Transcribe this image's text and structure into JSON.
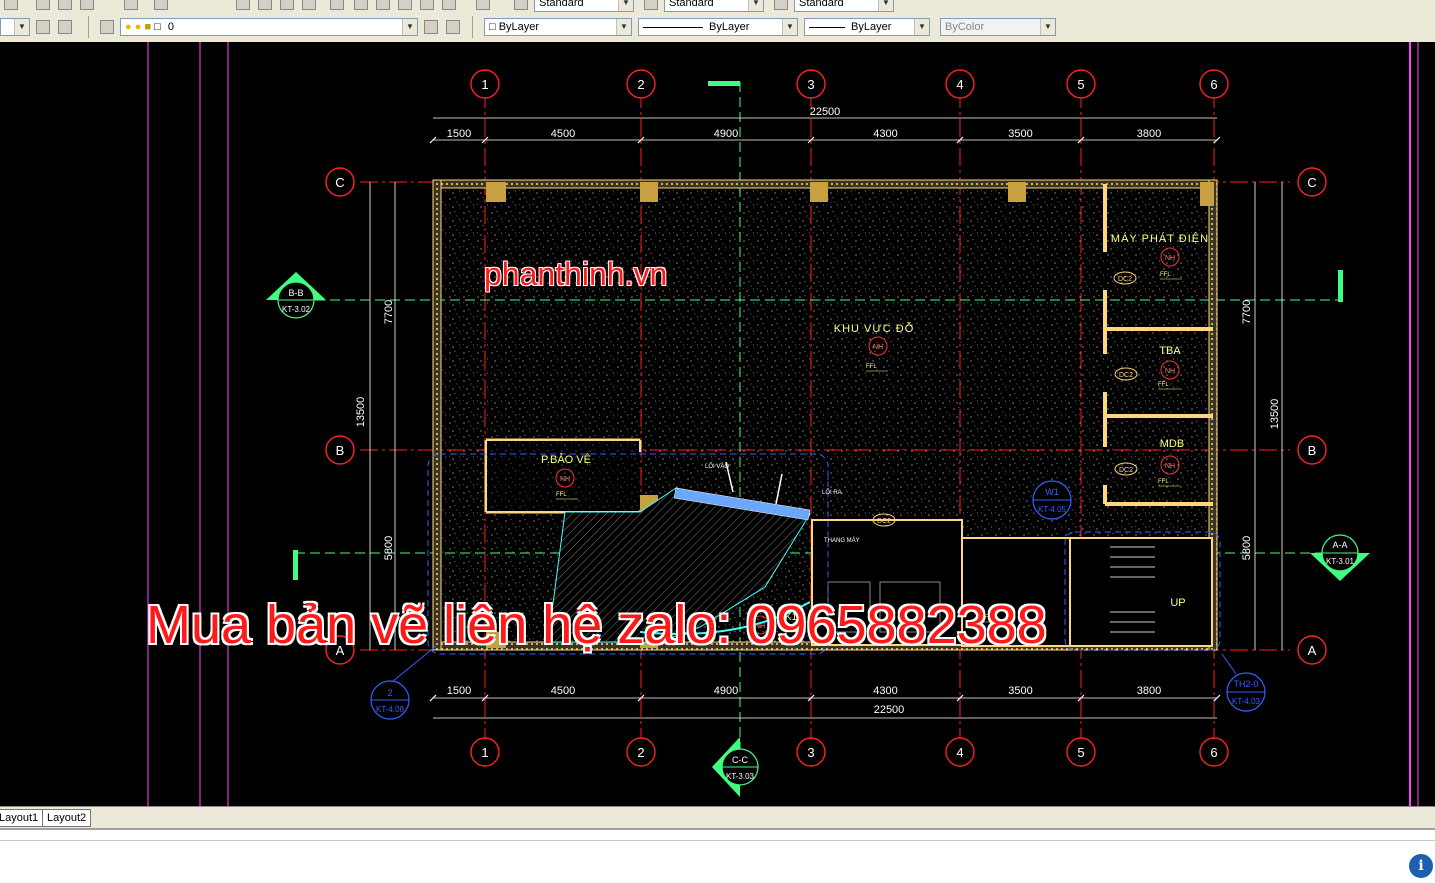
{
  "toolbar_top": {
    "text_style_1": "Standard",
    "text_style_2": "Standard",
    "text_style_3": "Standard"
  },
  "props": {
    "layer": "0",
    "color": "ByLayer",
    "linetype": "ByLayer",
    "lineweight": "ByLayer",
    "plotstyle": "ByColor"
  },
  "grid": {
    "columns": [
      "1",
      "2",
      "3",
      "4",
      "5",
      "6"
    ],
    "rows": [
      "A",
      "B",
      "C"
    ]
  },
  "dims": {
    "total_x": "22500",
    "spans_x": [
      "1500",
      "4500",
      "4900",
      "4300",
      "3500",
      "3800"
    ],
    "total_y": "13500",
    "spans_y": [
      "7700",
      "5800"
    ]
  },
  "rooms": {
    "main": "KHU VỰC ĐỖ",
    "generator": "MÁY PHÁT ĐIỆN",
    "tba": "TBA",
    "mdb": "MDB",
    "guard": "P.BẢO VỆ",
    "entry": "LỐI VÀO",
    "exit": "LỐI RA",
    "elevator": "THANG MÁY",
    "up": "UP",
    "ffl": "FFL",
    "nh": "NH",
    "dc2": "DC2",
    "k1": "K1"
  },
  "sections": {
    "bb": "B-B",
    "bb_ref": "KT-3.02",
    "aa": "A-A",
    "aa_ref": "KT-3.01",
    "cc": "C-C",
    "cc_ref": "KT-3.03",
    "d2": "2",
    "d2_ref": "KT-4.08",
    "w1": "W1",
    "w1_ref": "KT-4.05",
    "th2": "TH2-0",
    "th2_ref": "KT-4.03"
  },
  "watermarks": {
    "domain": "phanthinh.vn",
    "contact": "Mua bản vẽ liên hệ zalo: 0965882388"
  },
  "tabs": [
    "Layout1",
    "Layout2"
  ],
  "colors": {
    "grid": "#ff2020",
    "wall": "#ffd580",
    "hatch": "#ffffff",
    "dim": "#ffffff",
    "magenta": "#ff40ff",
    "cyan_section": "#40ff80",
    "blue": "#3060ff"
  }
}
